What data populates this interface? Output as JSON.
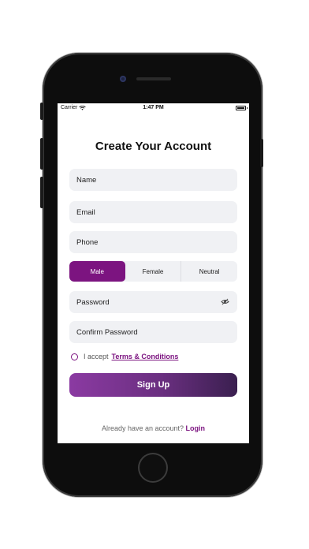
{
  "status_bar": {
    "carrier": "Carrier",
    "time": "1:47 PM"
  },
  "page": {
    "title": "Create Your Account"
  },
  "form": {
    "name_placeholder": "Name",
    "email_placeholder": "Email",
    "phone_placeholder": "Phone",
    "gender_options": [
      "Male",
      "Female",
      "Neutral"
    ],
    "gender_selected": "Male",
    "password_placeholder": "Password",
    "confirm_password_placeholder": "Confirm Password",
    "terms_prefix": "I accept",
    "terms_link": "Terms & Conditions",
    "signup_label": "Sign Up"
  },
  "footer": {
    "prompt": "Already have an account?",
    "login_label": "Login"
  },
  "colors": {
    "accent": "#7c1480",
    "field_bg": "#f0f1f4",
    "gradient_start": "#8b3aa2",
    "gradient_end": "#3a1f4f"
  },
  "icons": {
    "wifi": "wifi-icon",
    "battery": "battery-icon",
    "password_toggle": "eye-slash-icon"
  }
}
